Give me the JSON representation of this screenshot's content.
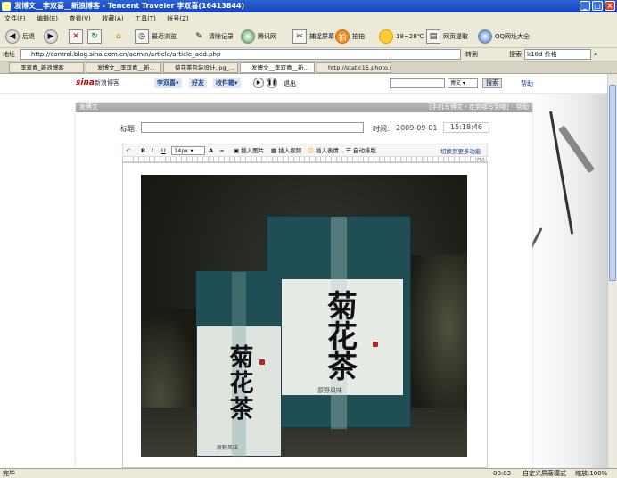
{
  "window": {
    "title": "发博文__李双喜__新浪博客 - Tencent Traveler  李双喜(16413844)",
    "min": "_",
    "max": "□",
    "close": "×"
  },
  "menu": [
    "文件(F)",
    "编辑(E)",
    "查看(V)",
    "收藏(A)",
    "工具(T)",
    "帐号(Z)"
  ],
  "toolbar": {
    "back": "后退",
    "recent": "最近浏览",
    "clear": "清除记录",
    "tencent_net": "腾讯网",
    "capture": "捕捉屏幕",
    "paipai": "拍拍",
    "weather": "18~28℃",
    "page_extract": "网页提取",
    "qq_nav": "QQ网址大全"
  },
  "address": {
    "label": "地址",
    "url": "http://control.blog.sina.com.cn/admin/article/article_add.php",
    "go": "转到",
    "search_label": "搜索",
    "search_value": "k10d 价格"
  },
  "tabs": [
    {
      "label": "李双喜_新浪博客"
    },
    {
      "label": "发博文__李双喜__新..."
    },
    {
      "label": "菊花茶包装设计.jpg_..."
    },
    {
      "label": "发博文__李双喜__新..."
    },
    {
      "label": "http://static15.photo.s..."
    }
  ],
  "sina": {
    "logo": "sina",
    "logo_sub": "新浪博客",
    "nav": [
      "李双喜▾",
      "好友",
      "收件箱▾"
    ],
    "exit": "退出",
    "search_select": "博文",
    "search_btn": "搜索",
    "help": "帮助"
  },
  "panel": {
    "header": "发博文",
    "header_right": "[手机写博文・走到哪写到哪]",
    "header_help": "帮助",
    "title_label": "标题:",
    "time_label": "时间:",
    "date": "2009-09-01",
    "time": "15:18:46"
  },
  "editor": {
    "font_size": "14px",
    "insert_image": "插入图片",
    "insert_video": "插入视频",
    "insert_emoji": "插入表情",
    "auto_layout": "自动排版",
    "switch_more": "切换到更多功能",
    "ruler_max": "750"
  },
  "photo": {
    "big_box_text": "菊花茶",
    "big_box_sub": "原野风味",
    "small_box_text": "菊花茶",
    "small_box_sub": "原野风味"
  },
  "status": {
    "left": "完毕",
    "time": "00:02",
    "mode": "自定义屏蔽模式",
    "zoom": "缩放:100%"
  }
}
